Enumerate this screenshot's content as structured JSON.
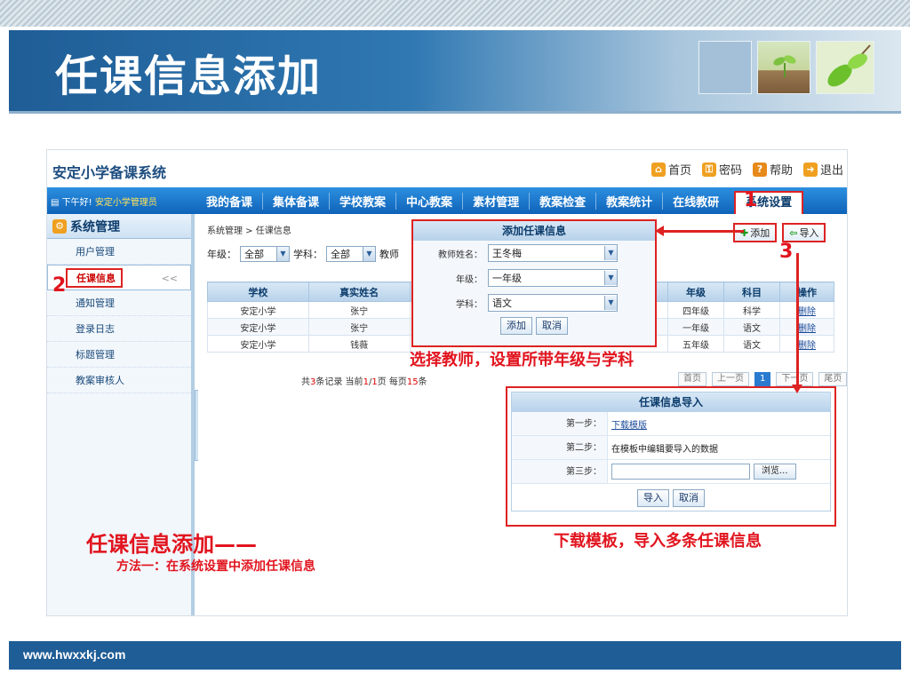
{
  "slide": {
    "title": "任课信息添加",
    "footer_url": "www.hwxxkj.com"
  },
  "app": {
    "name": "安定小学备课系统",
    "top_links": [
      {
        "label": "首页",
        "icon": "home-icon"
      },
      {
        "label": "密码",
        "icon": "key-icon"
      },
      {
        "label": "帮助",
        "icon": "help-icon"
      },
      {
        "label": "退出",
        "icon": "exit-icon"
      }
    ],
    "greeting": "下午好!",
    "user": "安定小学管理员",
    "nav": [
      "我的备课",
      "集体备课",
      "学校教案",
      "中心教案",
      "素材管理",
      "教案检查",
      "教案统计",
      "在线教研",
      "系统设置"
    ],
    "nav_active": "系统设置"
  },
  "sidebar": {
    "title": "系统管理",
    "items": [
      "用户管理",
      "任课信息",
      "通知管理",
      "登录日志",
      "标题管理",
      "教案审核人"
    ],
    "active": "任课信息",
    "collapse": "<<"
  },
  "content": {
    "breadcrumb": "系统管理 > 任课信息",
    "filter": {
      "grade_label": "年级：",
      "grade_value": "全部",
      "subject_label": "学科：",
      "subject_value": "全部",
      "teacher_label": "教师"
    },
    "buttons": {
      "add": "添加",
      "import": "导入"
    },
    "table": {
      "headers": [
        "学校",
        "真实姓名",
        "年级",
        "科目",
        "操作"
      ],
      "rows": [
        [
          "安定小学",
          "张宁",
          "四年级",
          "科学",
          "删除"
        ],
        [
          "安定小学",
          "张宁",
          "一年级",
          "语文",
          "删除"
        ],
        [
          "安定小学",
          "钱薇",
          "五年级",
          "语文",
          "删除"
        ]
      ]
    },
    "pager": {
      "text_pre": "共",
      "total": "3",
      "text_mid": "条记录 当前",
      "current": "1",
      "text_sep": "/",
      "pages": "1",
      "text_per": "页 每页",
      "per_page": "15",
      "text_end": "条",
      "buttons": [
        "首页",
        "上一页",
        "1",
        "下一页",
        "尾页"
      ]
    }
  },
  "add_dialog": {
    "title": "添加任课信息",
    "fields": [
      {
        "label": "教师姓名：",
        "value": "王冬梅"
      },
      {
        "label": "年级：",
        "value": "一年级"
      },
      {
        "label": "学科：",
        "value": "语文"
      }
    ],
    "confirm": "添加",
    "cancel": "取消"
  },
  "import_dialog": {
    "title": "任课信息导入",
    "step1_label": "第一步：",
    "step1_link": "下载模版",
    "step2_label": "第二步：",
    "step2_text": "在模板中编辑要导入的数据",
    "step3_label": "第三步：",
    "browse": "浏览...",
    "confirm": "导入",
    "cancel": "取消"
  },
  "annotations": {
    "num1": "1",
    "num2": "2",
    "num3": "3",
    "note_add": "选择教师，设置所带年级与学科",
    "note_import": "下载模板，导入多条任课信息",
    "heading": "任课信息添加——",
    "method": "方法一：在系统设置中添加任课信息"
  },
  "colors": {
    "banner": "#1f5d96",
    "nav": "#1a76cc",
    "annotation": "#e1141e"
  }
}
